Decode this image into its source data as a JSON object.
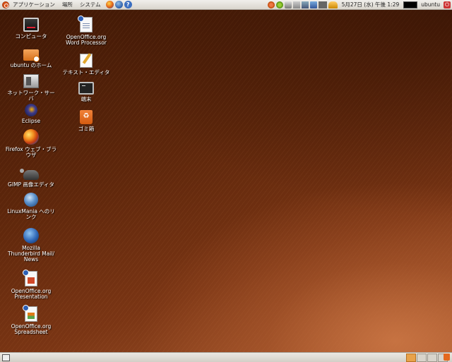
{
  "top_panel": {
    "menus": [
      "アプリケーション",
      "場所",
      "システム"
    ],
    "clock": "5月27日 (水) 午後 1:29",
    "user": "ubuntu"
  },
  "desktop": {
    "column1": [
      {
        "label": "コンピュータ",
        "icon": "computer-icon"
      },
      {
        "label": "ubuntu のホーム",
        "icon": "home-folder-icon"
      },
      {
        "label": "ネットワーク・サーバ",
        "icon": "network-server-icon"
      },
      {
        "label": "Eclipse",
        "icon": "eclipse-icon"
      },
      {
        "label": "Firefox ウェブ・ブラウザ",
        "icon": "firefox-icon"
      },
      {
        "label": "GIMP 画像エディタ",
        "icon": "gimp-icon"
      },
      {
        "label": "LinuxMania へのリンク",
        "icon": "globe-icon"
      },
      {
        "label": "Mozilla Thunderbird Mail/ News",
        "icon": "thunderbird-icon"
      },
      {
        "label": "OpenOffice.org Presentation",
        "icon": "presentation-icon"
      },
      {
        "label": "OpenOffice.org Spreadsheet",
        "icon": "spreadsheet-icon"
      }
    ],
    "column2": [
      {
        "label": "OpenOffice.org Word Processor",
        "icon": "word-processor-icon"
      },
      {
        "label": "テキスト・エディタ",
        "icon": "text-editor-icon"
      },
      {
        "label": "端末",
        "icon": "terminal-icon"
      },
      {
        "label": "ゴミ箱",
        "icon": "trash-icon"
      }
    ]
  }
}
